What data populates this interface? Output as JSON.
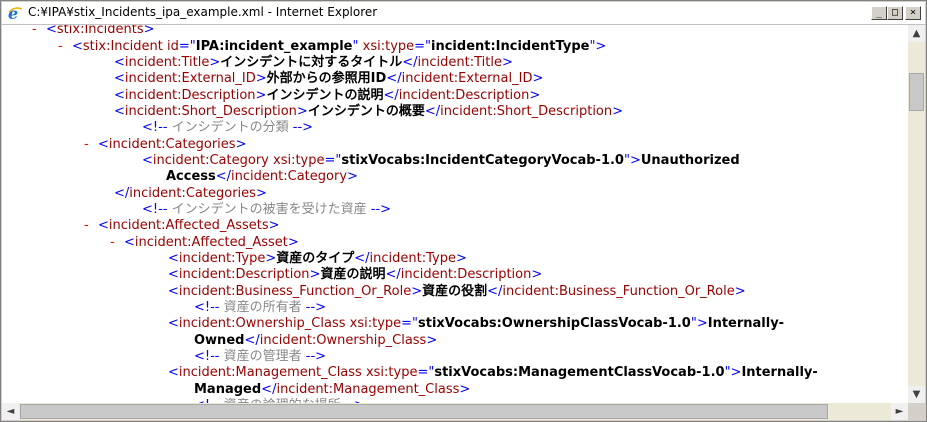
{
  "window": {
    "title": "C:¥IPA¥stix_Incidents_ipa_example.xml - Internet Explorer",
    "icon": "ie-icon",
    "min_label": "_",
    "max_label": "□",
    "close_label": "×"
  },
  "scroll": {
    "up": "▲",
    "down": "▼",
    "left": "◄",
    "right": "►"
  },
  "xml_lines": [
    {
      "minus": "-",
      "parts": [
        [
          "br",
          "<"
        ],
        [
          "tag",
          "stix:Incidents"
        ],
        [
          "br",
          ">"
        ]
      ]
    },
    {
      "minus": "-",
      "parts": [
        [
          "br",
          "<"
        ],
        [
          "tag",
          "stix:Incident "
        ],
        [
          "attr",
          "id"
        ],
        [
          "br",
          "=\""
        ],
        [
          "aval",
          "IPA:incident_example"
        ],
        [
          "br",
          "\" "
        ],
        [
          "attr",
          "xsi:type"
        ],
        [
          "br",
          "=\""
        ],
        [
          "aval",
          "incident:IncidentType"
        ],
        [
          "br",
          "\">"
        ]
      ]
    },
    {
      "parts": [
        [
          "br",
          "<"
        ],
        [
          "tag",
          "incident:Title"
        ],
        [
          "br",
          ">"
        ],
        [
          "txt",
          "インシデントに対するタイトル"
        ],
        [
          "br",
          "</"
        ],
        [
          "tag",
          "incident:Title"
        ],
        [
          "br",
          ">"
        ]
      ]
    },
    {
      "parts": [
        [
          "br",
          "<"
        ],
        [
          "tag",
          "incident:External_ID"
        ],
        [
          "br",
          ">"
        ],
        [
          "txt",
          "外部からの参照用ID"
        ],
        [
          "br",
          "</"
        ],
        [
          "tag",
          "incident:External_ID"
        ],
        [
          "br",
          ">"
        ]
      ]
    },
    {
      "parts": [
        [
          "br",
          "<"
        ],
        [
          "tag",
          "incident:Description"
        ],
        [
          "br",
          ">"
        ],
        [
          "txt",
          "インシデントの説明"
        ],
        [
          "br",
          "</"
        ],
        [
          "tag",
          "incident:Description"
        ],
        [
          "br",
          ">"
        ]
      ]
    },
    {
      "parts": [
        [
          "br",
          "<"
        ],
        [
          "tag",
          "incident:Short_Description"
        ],
        [
          "br",
          ">"
        ],
        [
          "txt",
          "インシデントの概要"
        ],
        [
          "br",
          "</"
        ],
        [
          "tag",
          "incident:Short_Description"
        ],
        [
          "br",
          ">"
        ]
      ]
    },
    {
      "parts": [
        [
          "br",
          "<!--"
        ],
        [
          "cmt",
          " インシデントの分類 "
        ],
        [
          "br",
          "-->"
        ]
      ]
    },
    {
      "minus": "-",
      "parts": [
        [
          "br",
          "<"
        ],
        [
          "tag",
          "incident:Categories"
        ],
        [
          "br",
          ">"
        ]
      ]
    },
    {
      "parts": [
        [
          "br",
          "<"
        ],
        [
          "tag",
          "incident:Category "
        ],
        [
          "attr",
          "xsi:type"
        ],
        [
          "br",
          "=\""
        ],
        [
          "aval",
          "stixVocabs:IncidentCategoryVocab-1.0"
        ],
        [
          "br",
          "\">"
        ],
        [
          "txt",
          "Unauthorized"
        ]
      ]
    },
    {
      "parts": [
        [
          "txt",
          "Access"
        ],
        [
          "br",
          "</"
        ],
        [
          "tag",
          "incident:Category"
        ],
        [
          "br",
          ">"
        ]
      ]
    },
    {
      "parts": [
        [
          "br",
          "</"
        ],
        [
          "tag",
          "incident:Categories"
        ],
        [
          "br",
          ">"
        ]
      ]
    },
    {
      "parts": [
        [
          "br",
          "<!--"
        ],
        [
          "cmt",
          " インシデントの被害を受けた資産 "
        ],
        [
          "br",
          "-->"
        ]
      ]
    },
    {
      "minus": "-",
      "parts": [
        [
          "br",
          "<"
        ],
        [
          "tag",
          "incident:Affected_Assets"
        ],
        [
          "br",
          ">"
        ]
      ]
    },
    {
      "minus": "-",
      "parts": [
        [
          "br",
          "<"
        ],
        [
          "tag",
          "incident:Affected_Asset"
        ],
        [
          "br",
          ">"
        ]
      ]
    },
    {
      "parts": [
        [
          "br",
          "<"
        ],
        [
          "tag",
          "incident:Type"
        ],
        [
          "br",
          ">"
        ],
        [
          "txt",
          "資産のタイプ"
        ],
        [
          "br",
          "</"
        ],
        [
          "tag",
          "incident:Type"
        ],
        [
          "br",
          ">"
        ]
      ]
    },
    {
      "parts": [
        [
          "br",
          "<"
        ],
        [
          "tag",
          "incident:Description"
        ],
        [
          "br",
          ">"
        ],
        [
          "txt",
          "資産の説明"
        ],
        [
          "br",
          "</"
        ],
        [
          "tag",
          "incident:Description"
        ],
        [
          "br",
          ">"
        ]
      ]
    },
    {
      "parts": [
        [
          "br",
          "<"
        ],
        [
          "tag",
          "incident:Business_Function_Or_Role"
        ],
        [
          "br",
          ">"
        ],
        [
          "txt",
          "資産の役割"
        ],
        [
          "br",
          "</"
        ],
        [
          "tag",
          "incident:Business_Function_Or_Role"
        ],
        [
          "br",
          ">"
        ]
      ]
    },
    {
      "parts": [
        [
          "br",
          "<!--"
        ],
        [
          "cmt",
          " 資産の所有者 "
        ],
        [
          "br",
          "-->"
        ]
      ]
    },
    {
      "parts": [
        [
          "br",
          "<"
        ],
        [
          "tag",
          "incident:Ownership_Class "
        ],
        [
          "attr",
          "xsi:type"
        ],
        [
          "br",
          "=\""
        ],
        [
          "aval",
          "stixVocabs:OwnershipClassVocab-1.0"
        ],
        [
          "br",
          "\">"
        ],
        [
          "txt",
          "Internally-"
        ]
      ]
    },
    {
      "parts": [
        [
          "txt",
          "Owned"
        ],
        [
          "br",
          "</"
        ],
        [
          "tag",
          "incident:Ownership_Class"
        ],
        [
          "br",
          ">"
        ]
      ]
    },
    {
      "parts": [
        [
          "br",
          "<!--"
        ],
        [
          "cmt",
          " 資産の管理者 "
        ],
        [
          "br",
          "-->"
        ]
      ]
    },
    {
      "parts": [
        [
          "br",
          "<"
        ],
        [
          "tag",
          "incident:Management_Class "
        ],
        [
          "attr",
          "xsi:type"
        ],
        [
          "br",
          "=\""
        ],
        [
          "aval",
          "stixVocabs:ManagementClassVocab-1.0"
        ],
        [
          "br",
          "\">"
        ],
        [
          "txt",
          "Internally-"
        ]
      ]
    },
    {
      "parts": [
        [
          "txt",
          "Managed"
        ],
        [
          "br",
          "</"
        ],
        [
          "tag",
          "incident:Management_Class"
        ],
        [
          "br",
          ">"
        ]
      ]
    },
    {
      "parts": [
        [
          "br",
          "<!--"
        ],
        [
          "cmt",
          " 資産の論理的な場所 "
        ],
        [
          "br",
          "-->"
        ]
      ]
    }
  ]
}
